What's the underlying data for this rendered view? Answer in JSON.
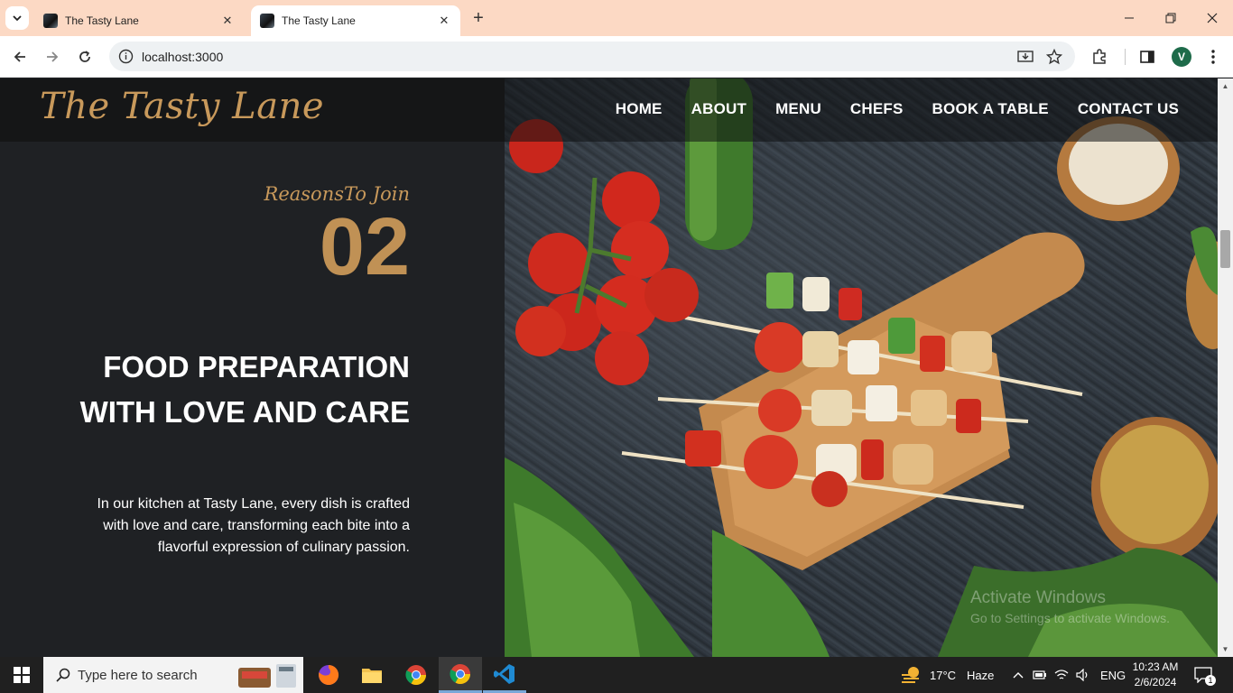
{
  "browser": {
    "tabs": [
      {
        "title": "The Tasty Lane",
        "active": false
      },
      {
        "title": "The Tasty Lane",
        "active": true
      }
    ],
    "close_glyph": "✕",
    "new_tab_glyph": "+",
    "url": "localhost:3000",
    "profile_initial": "V"
  },
  "site": {
    "logo": "The Tasty Lane",
    "nav": [
      "HOME",
      "ABOUT",
      "MENU",
      "CHEFS",
      "BOOK A TABLE",
      "CONTACT US"
    ],
    "section": {
      "eyebrow": "ReasonsTo Join",
      "number": "02",
      "heading": "FOOD PREPARATION WITH LOVE AND CARE",
      "description": "In our kitchen at Tasty Lane, every dish is crafted with love and care, transforming each bite into a flavorful expression of culinary passion."
    },
    "colors": {
      "accent": "#c8995b",
      "dark_panel": "#1f2124",
      "header": "#151617"
    }
  },
  "watermark": {
    "line1": "Activate Windows",
    "line2": "Go to Settings to activate Windows."
  },
  "taskbar": {
    "search_placeholder": "Type here to search",
    "weather": "17°C",
    "weather_condition": "Haze",
    "language": "ENG",
    "time": "10:23 AM",
    "date": "2/6/2024",
    "notification_count": "1"
  }
}
